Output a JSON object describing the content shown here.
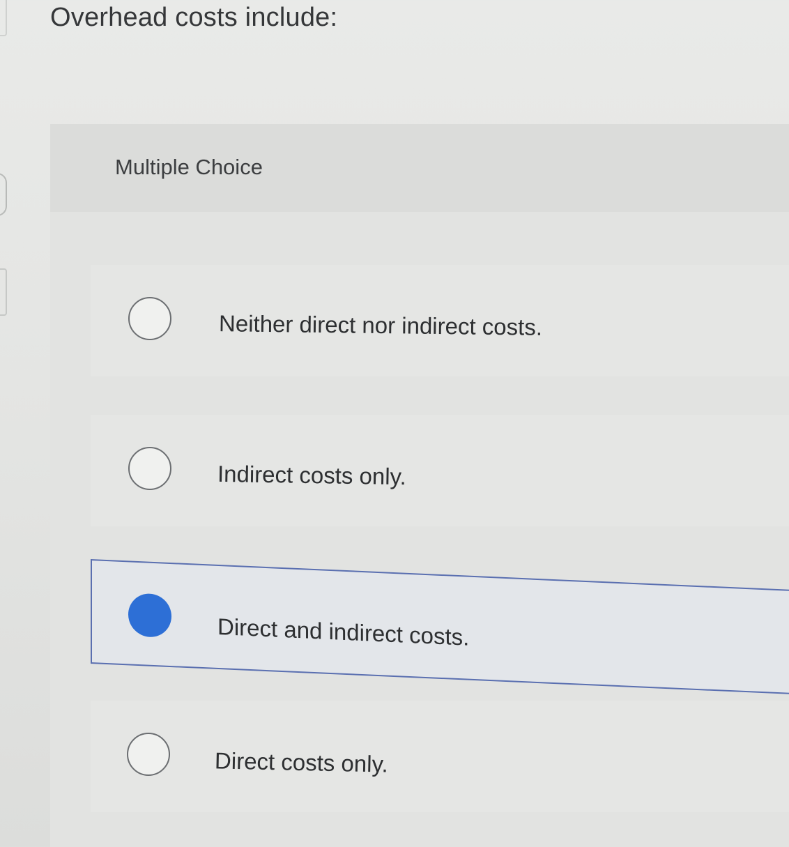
{
  "question": {
    "text": "Overhead costs include:"
  },
  "multiple_choice": {
    "label": "Multiple Choice",
    "options": [
      {
        "text": "Neither direct nor indirect costs.",
        "selected": false
      },
      {
        "text": "Indirect costs only.",
        "selected": false
      },
      {
        "text": "Direct and indirect costs.",
        "selected": true
      },
      {
        "text": "Direct costs only.",
        "selected": false
      }
    ]
  },
  "colors": {
    "selected_radio": "#2d6fd6",
    "selected_border": "#5a6fb0"
  },
  "icons": {
    "unselected": "radio-unchecked-icon",
    "selected": "radio-checked-icon"
  }
}
